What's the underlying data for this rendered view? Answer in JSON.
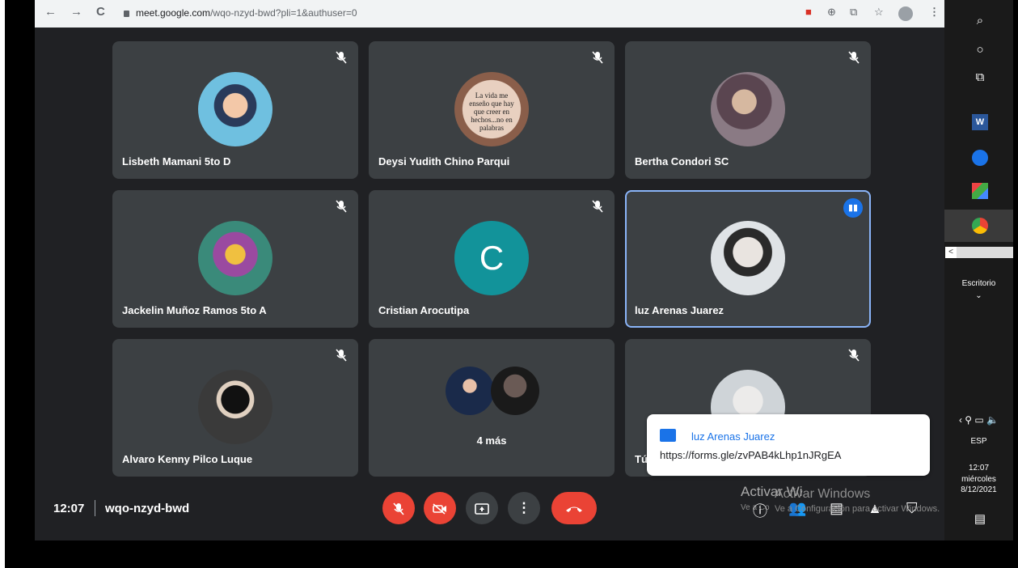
{
  "browser": {
    "url_host": "meet.google.com",
    "url_path": "/wqo-nzyd-bwd?pli=1&authuser=0",
    "nav": {
      "back": "←",
      "forward": "→",
      "reload": "C"
    },
    "right_icons": [
      "extension-icon",
      "zoom-icon",
      "cast-icon",
      "star-icon",
      "profile-avatar",
      "menu-icon"
    ]
  },
  "tiles": [
    {
      "name": "Lisbeth Mamani 5to D",
      "avatar_color": "#4fa3c7",
      "muted": true
    },
    {
      "name": "Deysi Yudith Chino Parqui",
      "avatar_color": "#c9a58a",
      "muted": true,
      "avatar_text": [
        "La vida me",
        "enseño que hay",
        "que creer en",
        "hechos...no en",
        "palabras"
      ]
    },
    {
      "name": "Bertha Condori SC",
      "avatar_color": "#6a5a66",
      "muted": true
    },
    {
      "name": "Jackelin Muñoz Ramos 5to A",
      "avatar_color": "#7a5c8a",
      "muted": true
    },
    {
      "name": "Cristian Arocutipa",
      "initial": "C",
      "avatar_color": "#12939a",
      "muted": true
    },
    {
      "name": "luz Arenas Juarez",
      "avatar_color": "#c8cfd6",
      "muted": false,
      "speaking": true
    },
    {
      "name": "Alvaro Kenny Pilco Luque",
      "avatar_color": "#2d2d2d",
      "muted": true
    },
    {
      "more": "4 más"
    },
    {
      "name": "Tú",
      "avatar_color": "#d8dde2",
      "muted": true
    }
  ],
  "bottom_bar": {
    "time": "12:07",
    "meeting_code": "wqo-nzyd-bwd",
    "controls": [
      "mic-off-button",
      "camera-off-button",
      "present-button",
      "more-options-button",
      "leave-call-button"
    ],
    "right_controls": [
      "info-button",
      "people-button",
      "chat-button",
      "activities-button",
      "host-controls-button"
    ]
  },
  "notification": {
    "sender": "luz Arenas Juarez",
    "message": "https://forms.gle/zvPAB4kLhp1nJRgEA"
  },
  "watermark": {
    "title": "Activar Windows",
    "subtitle": "Ve a Configuración para activar Windows.",
    "title_partial": "Activar Wi",
    "subtitle_partial": "Ve a Co"
  },
  "taskbar": {
    "desktop_label": "Escritorio",
    "lang": "ESP",
    "time": "12:07",
    "day": "miércoles",
    "date": "8/12/2021"
  },
  "colors": {
    "meet_bg": "#202124",
    "tile_bg": "#3c4043",
    "danger": "#ea4335",
    "accent": "#1a73e8"
  }
}
